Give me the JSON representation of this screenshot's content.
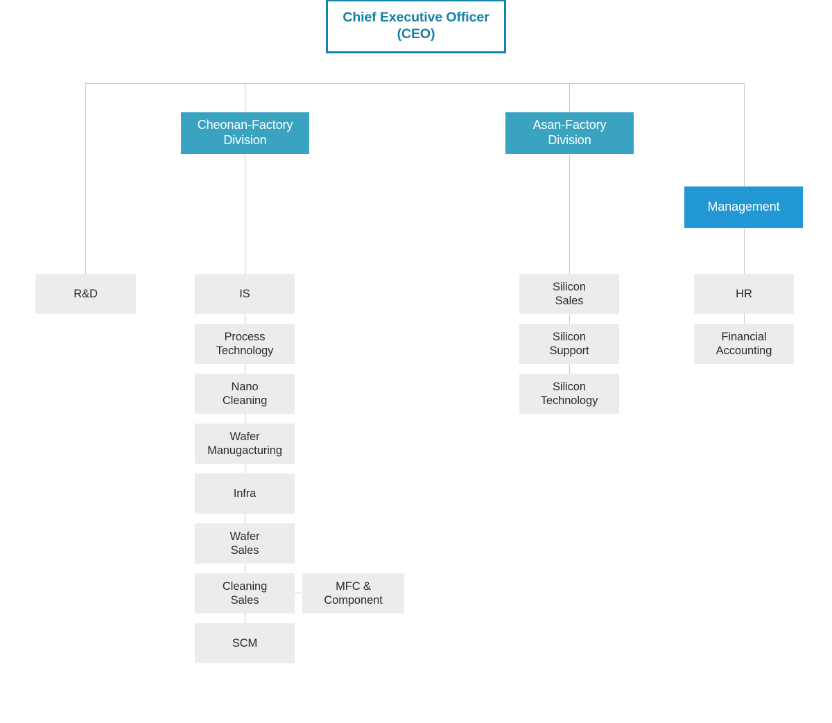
{
  "chart": {
    "title": "Organization Chart",
    "type": "org-chart",
    "colors": {
      "root_border": "#1581a8",
      "root_text": "#1581a8",
      "root_fill": "#ffffff",
      "division_fill": "#3aa3c0",
      "division_text": "#ffffff",
      "management_fill": "#2197d3",
      "management_text": "#ffffff",
      "leaf_fill": "#ececec",
      "leaf_text": "#2b2b2b",
      "connector": "#c9c9c9",
      "background": "#ffffff"
    }
  },
  "root": {
    "label": "Chief Executive Officer\n(CEO)",
    "line1": "Chief Executive Officer",
    "line2": "(CEO)"
  },
  "branches": [
    {
      "id": "rnd",
      "kind": "leaf-only",
      "children": [
        {
          "label": "R&D"
        }
      ]
    },
    {
      "id": "cheonan",
      "kind": "division",
      "header": {
        "label": "Cheonan-Factory\nDivision"
      },
      "children": [
        {
          "label": "IS"
        },
        {
          "label": "Process\nTechnology"
        },
        {
          "label": "Nano\nCleaning"
        },
        {
          "label": "Wafer\nManugacturing"
        },
        {
          "label": "Infra"
        },
        {
          "label": "Wafer\nSales"
        },
        {
          "label": "Cleaning\nSales",
          "sibling": {
            "label": "MFC &\nComponent"
          }
        },
        {
          "label": "SCM"
        }
      ]
    },
    {
      "id": "asan",
      "kind": "division",
      "header": {
        "label": "Asan-Factory\nDivision"
      },
      "children": [
        {
          "label": "Silicon\nSales"
        },
        {
          "label": "Silicon\nSupport"
        },
        {
          "label": "Silicon\nTechnology"
        }
      ]
    },
    {
      "id": "management",
      "kind": "management",
      "header": {
        "label": "Management"
      },
      "children": [
        {
          "label": "HR"
        },
        {
          "label": "Financial\nAccounting"
        }
      ]
    }
  ],
  "nodes": {
    "ceo": "Chief Executive Officer\n(CEO)",
    "cheonan_division": "Cheonan-Factory\nDivision",
    "asan_division": "Asan-Factory\nDivision",
    "management": "Management",
    "rnd": "R&D",
    "is": "IS",
    "process_technology": "Process\nTechnology",
    "nano_cleaning": "Nano\nCleaning",
    "wafer_manugacturing": "Wafer\nManugacturing",
    "infra": "Infra",
    "wafer_sales": "Wafer\nSales",
    "cleaning_sales": "Cleaning\nSales",
    "mfc_component": "MFC &\nComponent",
    "scm": "SCM",
    "silicon_sales": "Silicon\nSales",
    "silicon_support": "Silicon\nSupport",
    "silicon_technology": "Silicon\nTechnology",
    "hr": "HR",
    "financial_accounting": "Financial\nAccounting"
  }
}
